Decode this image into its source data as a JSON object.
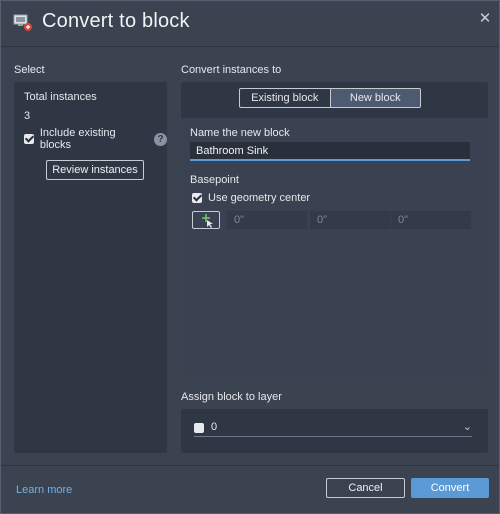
{
  "window": {
    "title": "Convert to block",
    "icon": "convert-block-icon",
    "close_icon": "close-icon"
  },
  "select_section": {
    "label": "Select",
    "total_instances_label": "Total instances",
    "total_instances_value": "3",
    "include_existing_label": "Include existing blocks",
    "include_existing_checked": true,
    "review_button": "Review instances"
  },
  "convert_section": {
    "label": "Convert instances to",
    "tabs": [
      {
        "label": "Existing block",
        "selected": false
      },
      {
        "label": "New block",
        "selected": true
      }
    ],
    "name_label": "Name the new block",
    "name_value": "Bathroom Sink",
    "basepoint_label": "Basepoint",
    "use_geometry_center_label": "Use geometry center",
    "use_geometry_center_checked": true,
    "pick_point_icon": "pick-point-icon",
    "coords": [
      "0\"",
      "0\"",
      "0\""
    ]
  },
  "layer_section": {
    "label": "Assign block to layer",
    "value": "0",
    "chevron_icon": "chevron-down-icon"
  },
  "footer": {
    "learn_more": "Learn more",
    "cancel_button": "Cancel",
    "convert_button": "Convert"
  },
  "colors": {
    "background": "#3b4250",
    "panel": "#303744",
    "accent": "#5c9ad6",
    "link": "#71b2e8"
  }
}
